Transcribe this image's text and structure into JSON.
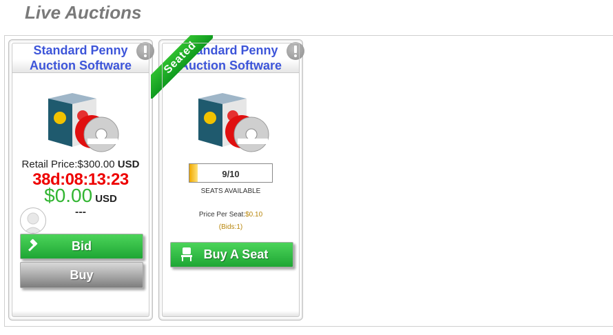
{
  "page": {
    "title": "Live Auctions"
  },
  "colors": {
    "title_blue": "#3d55d9",
    "timer_red": "#e00000",
    "price_green": "#32b532",
    "button_green": "#1ea634",
    "ribbon_green": "#0f9a1f",
    "gold": "#b8860b"
  },
  "cards": [
    {
      "title": "Standard Penny Auction Software",
      "retail_label": "Retail Price:",
      "retail_value": "$300.00",
      "retail_currency": "USD",
      "timer": "38d:08:13:23",
      "price": "$0.00",
      "price_currency": "USD",
      "bidder": "---",
      "bid_label": "Bid",
      "buy_label": "Buy",
      "icons": {
        "alert": "exclamation-icon",
        "bid": "gavel-icon",
        "avatar": "user-silhouette-icon"
      }
    },
    {
      "ribbon": "Seated",
      "title": "Standard Penny Auction Software",
      "seats_progress": "9/10",
      "seats_fraction": 0.1,
      "seats_label": "SEATS AVAILABLE",
      "price_per_seat_label": "Price Per Seat:",
      "price_per_seat_value": "$0.10",
      "bids": "(Bids:1)",
      "buy_seat_label": "Buy A Seat",
      "icons": {
        "alert": "exclamation-icon",
        "seat": "chair-icon"
      }
    }
  ]
}
